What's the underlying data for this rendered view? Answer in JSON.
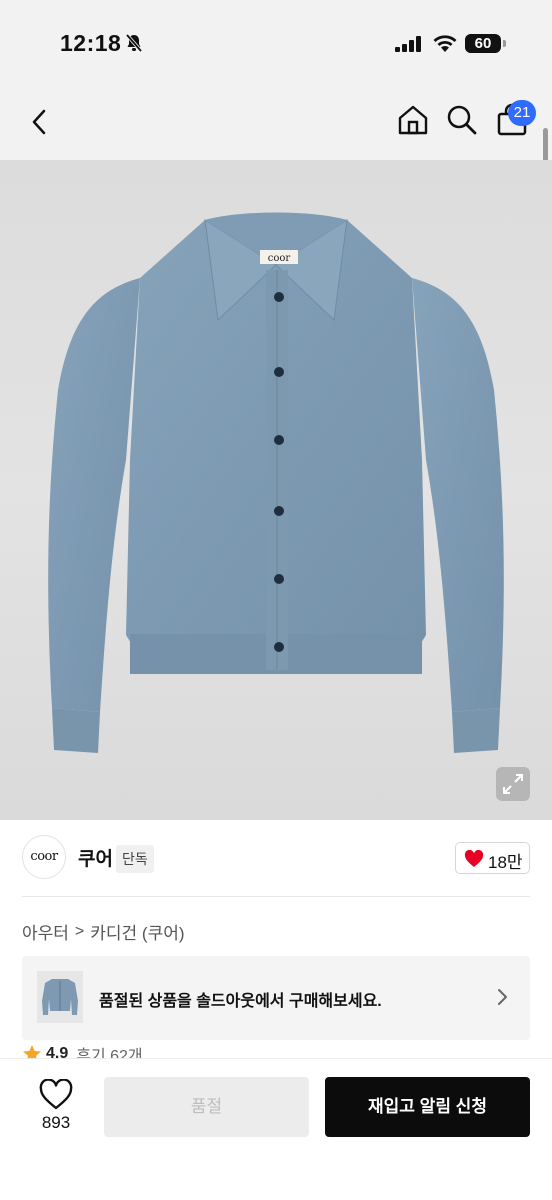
{
  "status_bar": {
    "time": "12:18",
    "battery": "60"
  },
  "header": {
    "cart_count": "21"
  },
  "product": {
    "image_label": "coor"
  },
  "brand": {
    "logo_text": "coor",
    "name": "쿠어",
    "tag": "단독",
    "like_count": "18만"
  },
  "breadcrumb": {
    "items": [
      "아우터",
      "카디건 (쿠어)"
    ],
    "separator": ">"
  },
  "soldout_banner": {
    "text": "품절된 상품을 솔드아웃에서 구매해보세요."
  },
  "rating": {
    "value": "4.9",
    "reviews": "후기 62개"
  },
  "bottom_bar": {
    "wish_count": "893",
    "soldout_label": "품절",
    "restock_label": "재입고 알림 신청"
  },
  "colors": {
    "accent": "#2f6bff",
    "heart": "#e60023",
    "star": "#f5a623",
    "product_knit": "#7f9db5"
  }
}
